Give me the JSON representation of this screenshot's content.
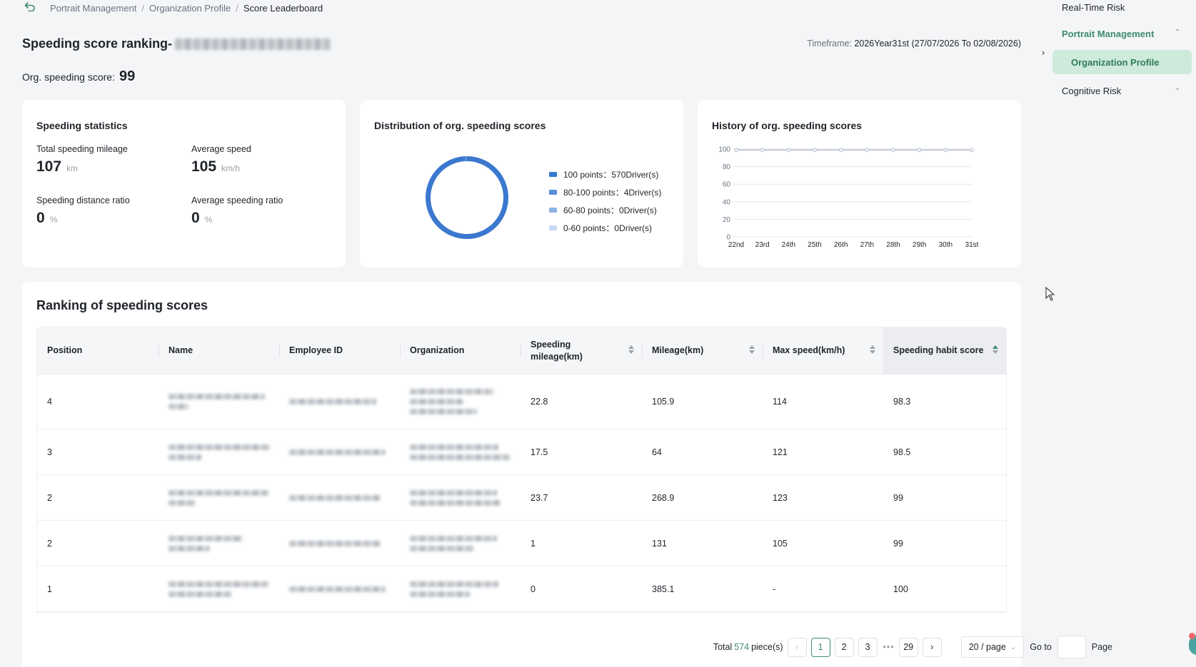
{
  "breadcrumb": {
    "items": [
      "Portrait Management",
      "Organization Profile",
      "Score Leaderboard"
    ],
    "separator": "/"
  },
  "header": {
    "title_prefix": "Speeding score ranking-",
    "timeframe_label": "Timeframe:",
    "timeframe_value": "2026Year31st (27/07/2026 To 02/08/2026)",
    "org_score_label": "Org. speeding score:",
    "org_score_value": "99"
  },
  "stats_card": {
    "title": "Speeding statistics",
    "items": [
      {
        "label": "Total speeding mileage",
        "value": "107",
        "unit": "km"
      },
      {
        "label": "Average speed",
        "value": "105",
        "unit": "km/h"
      },
      {
        "label": "Speeding distance ratio",
        "value": "0",
        "unit": "%"
      },
      {
        "label": "Average speeding ratio",
        "value": "0",
        "unit": "%"
      }
    ]
  },
  "dist_card": {
    "title": "Distribution of org. speeding scores",
    "legend": [
      {
        "label": "100 points：570Driver(s)",
        "color": "#3b78d0"
      },
      {
        "label": "80-100 points：4Driver(s)",
        "color": "#5b8ed8"
      },
      {
        "label": "60-80 points：0Driver(s)",
        "color": "#8fb3e6"
      },
      {
        "label": "0-60 points：0Driver(s)",
        "color": "#c7d9f3"
      }
    ]
  },
  "hist_card": {
    "title": "History of org. speeding scores"
  },
  "chart_data": [
    {
      "type": "pie",
      "variant": "donut",
      "categories": [
        "100 points",
        "80-100 points",
        "60-80 points",
        "0-60 points"
      ],
      "values": [
        570,
        4,
        0,
        0
      ],
      "unit": "Driver(s)",
      "colors": [
        "#3b78d0",
        "#5b8ed8",
        "#8fb3e6",
        "#c7d9f3"
      ]
    },
    {
      "type": "line",
      "x": [
        "22nd",
        "23rd",
        "24th",
        "25th",
        "26th",
        "27th",
        "28th",
        "29th",
        "30th",
        "31st"
      ],
      "y_ticks": [
        "0",
        "20",
        "40",
        "60",
        "80",
        "100"
      ],
      "ylim": [
        0,
        100
      ],
      "grid": true,
      "series": [
        {
          "values": [
            99,
            99,
            99,
            99,
            99,
            99,
            99,
            99,
            99,
            99
          ],
          "color": "#b9c2cc"
        }
      ]
    }
  ],
  "ranking": {
    "title": "Ranking of speeding scores",
    "columns": [
      "Position",
      "Name",
      "Employee ID",
      "Organization",
      "Speeding mileage(km)",
      "Mileage(km)",
      "Max speed(km/h)",
      "Speeding habit score"
    ],
    "rows": [
      {
        "position": "4",
        "speeding_mileage": "22.8",
        "mileage": "105.9",
        "max_speed": "114",
        "score": "98.3"
      },
      {
        "position": "3",
        "speeding_mileage": "17.5",
        "mileage": "64",
        "max_speed": "121",
        "score": "98.5"
      },
      {
        "position": "2",
        "speeding_mileage": "23.7",
        "mileage": "268.9",
        "max_speed": "123",
        "score": "99"
      },
      {
        "position": "2",
        "speeding_mileage": "1",
        "mileage": "131",
        "max_speed": "105",
        "score": "99"
      },
      {
        "position": "1",
        "speeding_mileage": "0",
        "mileage": "385.1",
        "max_speed": "-",
        "score": "100"
      }
    ]
  },
  "pagination": {
    "total_prefix": "Total",
    "total_count": "574",
    "total_suffix": "piece(s)",
    "pages": [
      "1",
      "2",
      "3",
      "29"
    ],
    "current_page": "1",
    "dots": "•••",
    "page_size": "20 / page",
    "goto_label": "Go to",
    "page_label": "Page"
  },
  "sidebar": {
    "real_time_risk": "Real-Time Risk",
    "portrait_management": "Portrait Management",
    "organization_profile": "Organization Profile",
    "cognitive_risk": "Cognitive Risk"
  },
  "accent_color": "#3d8c6a"
}
